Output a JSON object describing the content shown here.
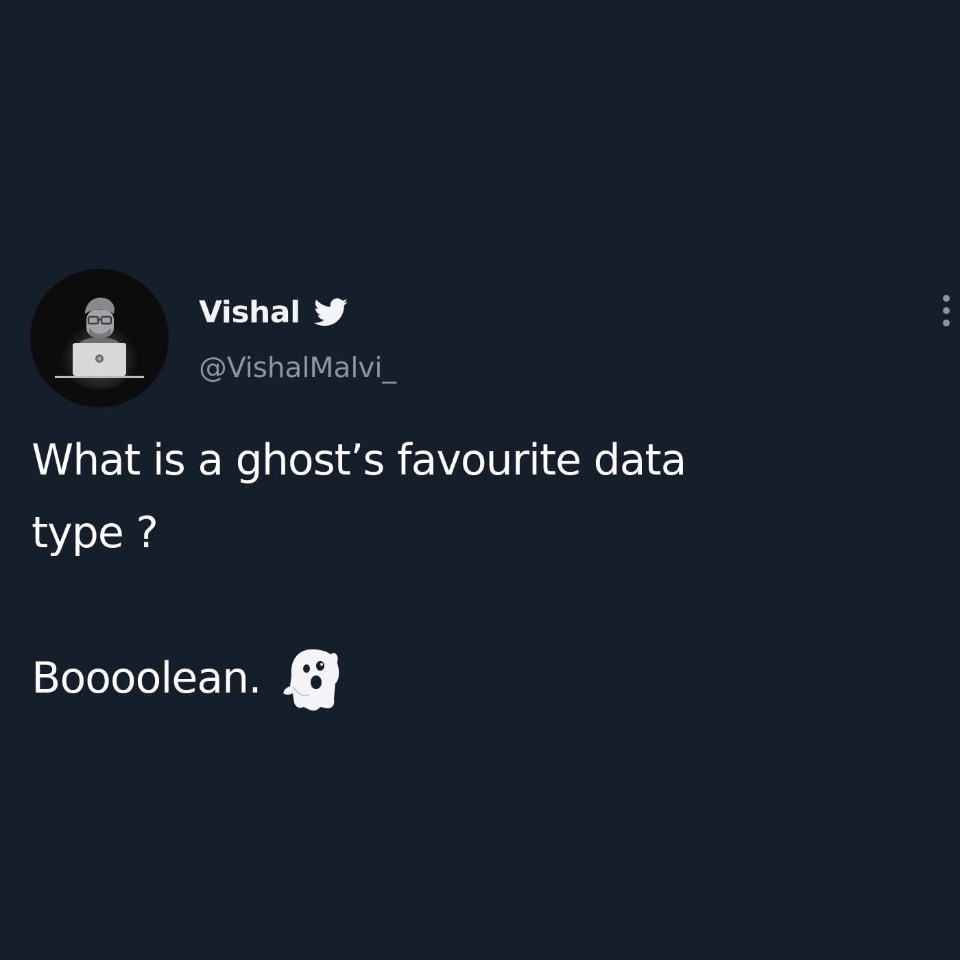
{
  "tweet": {
    "author": {
      "display_name": "Vishal",
      "handle": "@VishalMalvi_",
      "avatar_icon": "developer-at-laptop-avatar",
      "verified_icon": "twitter-bird-icon"
    },
    "menu_icon": "vertical-ellipsis-icon",
    "text": {
      "line1": "What is a ghost’s favourite data",
      "line2": "type ?",
      "answer": "Boooolean."
    },
    "answer_emoji": "ghost-icon"
  },
  "colors": {
    "background": "#161e29",
    "primary_text": "#ffffff",
    "secondary_text": "#8b96a0"
  }
}
